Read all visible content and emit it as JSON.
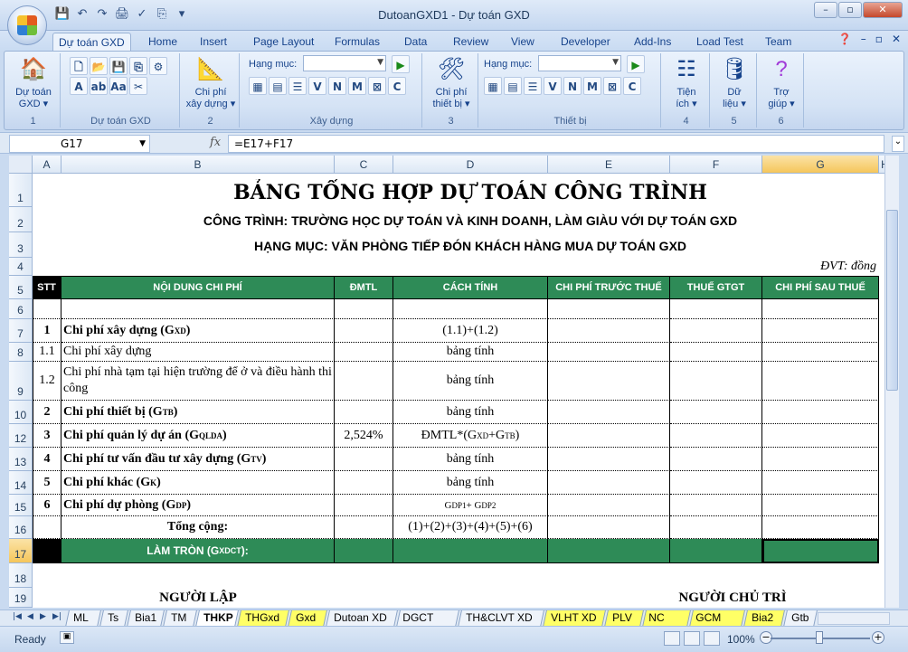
{
  "window": {
    "title": "DutoanGXD1 - Dự toán GXD",
    "minimize": "–",
    "restore": "▫",
    "close": "✕"
  },
  "tabs": [
    "Dự toán GXD",
    "Home",
    "Insert",
    "Page Layout",
    "Formulas",
    "Data",
    "Review",
    "View",
    "Developer",
    "Add-Ins",
    "Load Test",
    "Team"
  ],
  "ribbon": {
    "du_toan": {
      "label1": "Dự toán",
      "label2": "GXD ▾",
      "num": "1"
    },
    "group_du_toan_gxd": "Dự toán GXD",
    "chi_phi_xay_dung": {
      "label1": "Chi phí",
      "label2": "xây dựng ▾",
      "num": "2"
    },
    "hang_muc_label": "Hạng mục:",
    "group_xay_dung": "Xây dựng",
    "chi_phi_thiet_bi": {
      "label1": "Chi phí",
      "label2": "thiết bị ▾",
      "num": "3"
    },
    "group_thiet_bi": "Thiết bị",
    "tien_ich": {
      "label1": "Tiện",
      "label2": "ích ▾",
      "num": "4"
    },
    "du_lieu": {
      "label1": "Dữ",
      "label2": "liệu ▾",
      "num": "5"
    },
    "tro_giup": {
      "label1": "Trợ",
      "label2": "giúp ▾",
      "num": "6"
    },
    "letters": [
      "V",
      "N",
      "M",
      "C"
    ]
  },
  "formula_bar": {
    "name_box": "G17",
    "fx": "fx",
    "formula": "=E17+F17"
  },
  "columns": [
    "A",
    "B",
    "C",
    "D",
    "E",
    "F",
    "G",
    "H"
  ],
  "sheet": {
    "title": "BẢNG TỔNG HỢP DỰ TOÁN CÔNG TRÌNH",
    "project": "CÔNG TRÌNH: TRƯỜNG HỌC DỰ TOÁN VÀ KINH DOANH, LÀM GIÀU VỚI DỰ TOÁN GXD",
    "item": "HẠNG MỤC: VĂN PHÒNG TIẾP ĐÓN KHÁCH HÀNG MUA DỰ TOÁN GXD",
    "unit": "ĐVT: đồng",
    "headers": {
      "stt": "STT",
      "content": "NỘI DUNG CHI PHÍ",
      "dmtl": "ĐMTL",
      "method": "CÁCH TÍNH",
      "before_tax": "CHI PHÍ TRƯỚC THUẾ",
      "vat": "THUẾ GTGT",
      "after_tax": "CHI PHÍ SAU THUẾ"
    },
    "rows": [
      {
        "stt": "1",
        "label": "Chi phí xây dựng (G",
        "sub": "XD",
        "tail": ")",
        "bold": true,
        "method": "(1.1)+(1.2)"
      },
      {
        "stt": "1.1",
        "label": "Chi phí xây dựng",
        "method": "bảng tính"
      },
      {
        "stt": "1.2",
        "label": "Chi phí nhà tạm tại hiện trường để ở và điều hành thi công",
        "method": "bảng tính"
      },
      {
        "stt": "2",
        "label": "Chi phí thiết bị (G",
        "sub": "TB",
        "tail": ")",
        "bold": true,
        "method": "bảng tính"
      },
      {
        "stt": "3",
        "label": "Chi phí quản lý dự án (G",
        "sub": "QLDA",
        "tail": ")",
        "bold": true,
        "dmtl": "2,524%",
        "method": "ĐMTL*(G",
        "msub1": "XD",
        "mmid": "+G",
        "msub2": "TB",
        "mtail": ")"
      },
      {
        "stt": "4",
        "label": "Chi phí tư vấn đầu tư xây dựng (G",
        "sub": "TV",
        "tail": ")",
        "bold": true,
        "method": "bảng tính"
      },
      {
        "stt": "5",
        "label": "Chi phí khác (G",
        "sub": "K",
        "tail": ")",
        "bold": true,
        "method": "bảng tính"
      },
      {
        "stt": "6",
        "label": "Chi phí dự phòng (G",
        "sub": "DP",
        "tail": ")",
        "bold": true,
        "method": "G",
        "msub1": "DP1",
        "mmid": " + G",
        "msub2": "DP2",
        "mtail": ""
      }
    ],
    "total_label": "Tổng cộng:",
    "total_method": "(1)+(2)+(3)+(4)+(5)+(6)",
    "round_label": "LÀM TRÒN (G",
    "round_sub": "XDCT",
    "round_tail": "):",
    "signer_left": "NGƯỜI LẬP",
    "signer_right": "NGƯỜI CHỦ TRÌ"
  },
  "row_numbers": [
    "1",
    "2",
    "3",
    "4",
    "5",
    "6",
    "7",
    "8",
    "9",
    "10",
    "11",
    "12",
    "13",
    "14",
    "15",
    "16",
    "17",
    "18",
    "19"
  ],
  "sheet_tabs": [
    {
      "name": "ML"
    },
    {
      "name": "Ts"
    },
    {
      "name": "Bia1"
    },
    {
      "name": "TM"
    },
    {
      "name": "THKP",
      "active": true
    },
    {
      "name": "THGxd",
      "yellow": true
    },
    {
      "name": "Gxd",
      "yellow": true
    },
    {
      "name": "Dutoan XD"
    },
    {
      "name": "DGCT XD"
    },
    {
      "name": "TH&CLVT XD"
    },
    {
      "name": "VLHT XD",
      "yellow": true
    },
    {
      "name": "PLV",
      "yellow": true
    },
    {
      "name": "NC XD",
      "yellow": true
    },
    {
      "name": "GCM XD",
      "yellow": true
    },
    {
      "name": "Bia2",
      "yellow": true
    },
    {
      "name": "Gtb"
    }
  ],
  "status": {
    "ready": "Ready",
    "zoom": "100%"
  }
}
